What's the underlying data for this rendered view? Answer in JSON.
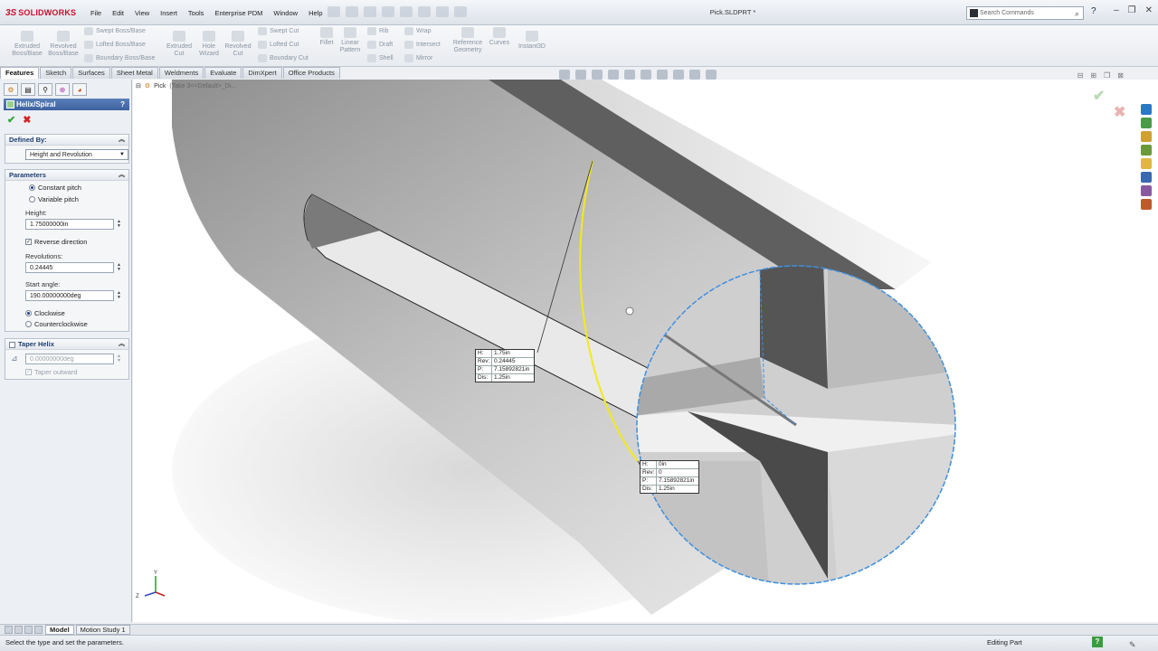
{
  "app": {
    "brand_ds": "3S",
    "brand_name": "SOLIDWORKS",
    "doc_title": "Pick.SLDPRT *",
    "menu": [
      "File",
      "Edit",
      "View",
      "Insert",
      "Tools",
      "Enterprise PDM",
      "Window",
      "Help"
    ],
    "search_placeholder": "Search Commands",
    "help_glyph": "?"
  },
  "command_manager": {
    "extruded_boss": [
      "Extruded",
      "Boss/Base"
    ],
    "revolved_boss": [
      "Revolved",
      "Boss/Base"
    ],
    "swept_boss": "Swept Boss/Base",
    "lofted_boss": "Lofted Boss/Base",
    "boundary_boss": "Boundary Boss/Base",
    "extruded_cut": [
      "Extruded",
      "Cut"
    ],
    "hole_wizard": [
      "Hole",
      "Wizard"
    ],
    "revolved_cut": [
      "Revolved",
      "Cut"
    ],
    "swept_cut": "Swept Cut",
    "lofted_cut": "Lofted Cut",
    "boundary_cut": "Boundary Cut",
    "fillet": "Fillet",
    "linear_pattern": [
      "Linear",
      "Pattern"
    ],
    "rib": "Rib",
    "draft": "Draft",
    "shell": "Shell",
    "wrap": "Wrap",
    "intersect": "Intersect",
    "mirror": "Mirror",
    "reference_geometry": [
      "Reference",
      "Geometry"
    ],
    "curves": "Curves",
    "instant3d": "Instant3D"
  },
  "tabs": [
    "Features",
    "Sketch",
    "Surfaces",
    "Sheet Metal",
    "Weldments",
    "Evaluate",
    "DimXpert",
    "Office Products"
  ],
  "property_manager": {
    "title": "Helix/Spiral",
    "help": "?",
    "ok_glyph": "✔",
    "cancel_glyph": "✖",
    "defined_by": {
      "heading": "Defined By:",
      "value": "Height and Revolution"
    },
    "parameters": {
      "heading": "Parameters",
      "constant_pitch": "Constant pitch",
      "variable_pitch": "Variable pitch",
      "height_label": "Height:",
      "height_value": "1.75000000in",
      "reverse_direction": "Reverse direction",
      "revolutions_label": "Revolutions:",
      "revolutions_value": "0.24445",
      "start_angle_label": "Start angle:",
      "start_angle_value": "190.00000000deg",
      "clockwise": "Clockwise",
      "counterclockwise": "Counterclockwise"
    },
    "taper_helix": {
      "heading": "Taper Helix",
      "angle_value": "0.00000000deg",
      "taper_outward": "Taper outward"
    }
  },
  "viewport": {
    "tree_label": "Pick",
    "tree_suffix": "(Take 3<<Default>_Di..."
  },
  "callouts": [
    {
      "rows": [
        [
          "H:",
          "1.75in"
        ],
        [
          "Rev:",
          "0.24445"
        ],
        [
          "P:",
          "7.15892821in"
        ],
        [
          "Dis:",
          "1.25in"
        ]
      ]
    },
    {
      "rows": [
        [
          "H:",
          "0in"
        ],
        [
          "Rev:",
          "0"
        ],
        [
          "P:",
          "7.15892821in"
        ],
        [
          "Dis:",
          "1.25in"
        ]
      ]
    }
  ],
  "model_tabs": [
    "Model",
    "Motion Study 1"
  ],
  "status": {
    "message": "Select the type and set the parameters.",
    "mode": "Editing Part"
  },
  "colors": {
    "helix": "#f2ea1a",
    "magnify": "#3f8fde",
    "accent": "#3d62a0"
  }
}
